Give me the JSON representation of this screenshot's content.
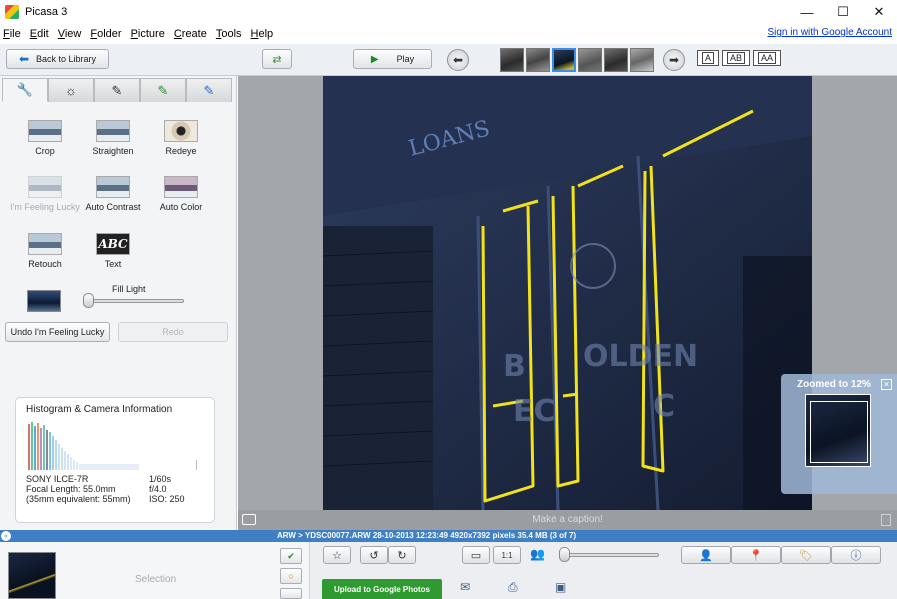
{
  "window": {
    "title": "Picasa 3",
    "controls": [
      "—",
      "☐",
      "✕"
    ]
  },
  "menu": {
    "items": [
      "File",
      "Edit",
      "View",
      "Folder",
      "Picture",
      "Create",
      "Tools",
      "Help"
    ],
    "sign_in": "Sign in with Google Account"
  },
  "toolbar": {
    "back_label": "Back to Library",
    "play_label": "Play",
    "view_modes": [
      "A",
      "AB",
      "AA"
    ]
  },
  "edit_panel": {
    "tabs": [
      "wrench-icon",
      "sun-icon",
      "brush-icon",
      "green-brush-icon",
      "blue-brush-icon"
    ],
    "tools": [
      {
        "label": "Crop",
        "enabled": true
      },
      {
        "label": "Straighten",
        "enabled": true
      },
      {
        "label": "Redeye",
        "enabled": true
      },
      {
        "label": "I'm Feeling Lucky",
        "enabled": false
      },
      {
        "label": "Auto Contrast",
        "enabled": true
      },
      {
        "label": "Auto Color",
        "enabled": true
      },
      {
        "label": "Retouch",
        "enabled": true
      },
      {
        "label": "Text",
        "enabled": true
      }
    ],
    "text_icon_label": "ABC",
    "fill_light_label": "Fill Light",
    "fill_light_value": 0,
    "undo_label": "Undo I'm Feeling Lucky",
    "redo_label": "Redo"
  },
  "histogram": {
    "title": "Histogram & Camera Information",
    "camera": "SONY ILCE-7R",
    "focal_length": "Focal Length: 55.0mm",
    "equivalent": "(35mm equivalent:  55mm)",
    "shutter": "1/60s",
    "aperture": "f/4.0",
    "iso": "ISO: 250"
  },
  "photo": {
    "sign_text": "LOANS",
    "caption_placeholder": "Make a caption!"
  },
  "zoom": {
    "label": "Zoomed to  12%",
    "close": "✕"
  },
  "status": {
    "text": "ARW > YDSC00077.ARW     28-10-2013 12:23:49     4920x7392 pixels     35.4 MB     (3 of 7)"
  },
  "tray": {
    "selection_label": "Selection",
    "upload_label": "Upload to Google Photos",
    "ratio_label": "1:1"
  }
}
